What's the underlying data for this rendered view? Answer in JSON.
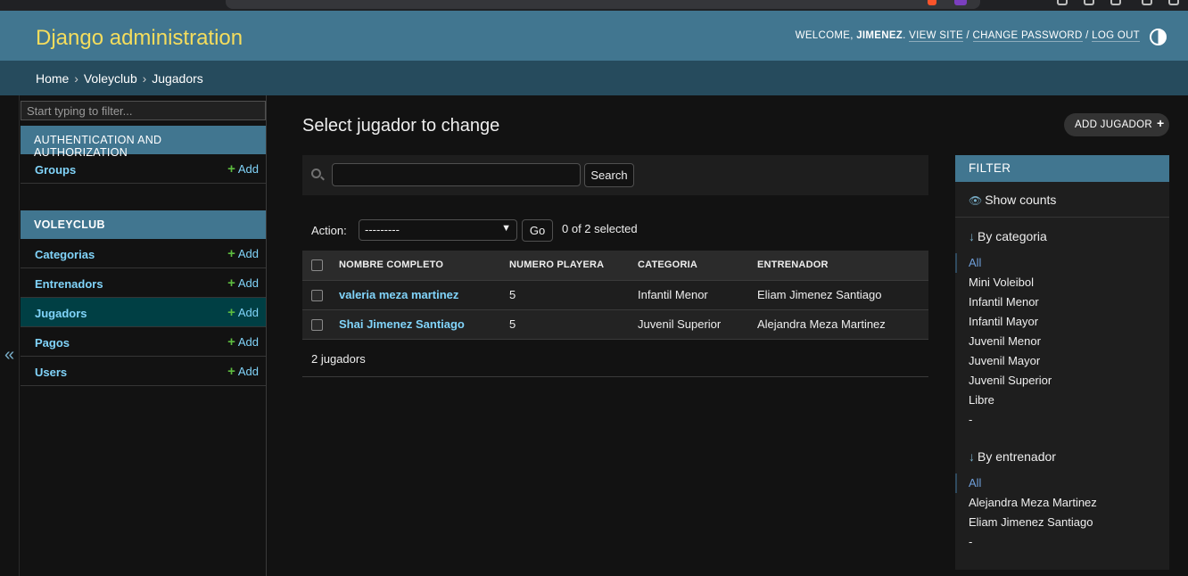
{
  "header": {
    "site_name": "Django administration",
    "welcome": "WELCOME,",
    "username": "JIMENEZ",
    "view_site": "VIEW SITE",
    "change_password": "CHANGE PASSWORD",
    "log_out": "LOG OUT",
    "separator": "/"
  },
  "breadcrumbs": {
    "home": "Home",
    "app": "Voleyclub",
    "current": "Jugadors",
    "separator": "›"
  },
  "sidebar": {
    "toggle_icon": "«",
    "filter_placeholder": "Start typing to filter...",
    "add_label": "Add",
    "modules": [
      {
        "caption": "AUTHENTICATION AND AUTHORIZATION",
        "models": [
          "Groups"
        ]
      },
      {
        "caption": "VOLEYCLUB",
        "models": [
          "Categorias",
          "Entrenadors",
          "Jugadors",
          "Pagos",
          "Users"
        ],
        "current": "Jugadors"
      }
    ]
  },
  "content": {
    "title": "Select jugador to change",
    "add_button": "ADD JUGADOR",
    "search": {
      "value": "",
      "button": "Search"
    },
    "actions": {
      "label": "Action:",
      "selected": "---------",
      "go": "Go",
      "counter": "0 of 2 selected"
    },
    "table": {
      "columns": [
        "NOMBRE COMPLETO",
        "NUMERO PLAYERA",
        "CATEGORIA",
        "ENTRENADOR"
      ],
      "rows": [
        {
          "nombre": "valeria meza martinez",
          "numero": "5",
          "categoria": "Infantil Menor",
          "entrenador": "Eliam Jimenez Santiago"
        },
        {
          "nombre": "Shai Jimenez Santiago",
          "numero": "5",
          "categoria": "Juvenil Superior",
          "entrenador": "Alejandra Meza Martinez"
        }
      ]
    },
    "paginator": "2 jugadors"
  },
  "filter": {
    "caption": "FILTER",
    "show_counts": "Show counts",
    "groups": [
      {
        "title": "By categoria",
        "options": [
          "All",
          "Mini Voleibol",
          "Infantil Menor",
          "Infantil Mayor",
          "Juvenil Menor",
          "Juvenil Mayor",
          "Juvenil Superior",
          "Libre",
          "-"
        ],
        "selected": "All"
      },
      {
        "title": "By entrenador",
        "options": [
          "All",
          "Alejandra Meza Martinez",
          "Eliam Jimenez Santiago",
          "-"
        ],
        "selected": "All"
      }
    ]
  },
  "icons": {
    "add": "plus-icon",
    "search": "search-icon",
    "eye": "eye-icon",
    "theme": "theme-toggle-icon",
    "sort": "arrow-down-icon"
  },
  "colors": {
    "header_bg": "#417690",
    "site_name": "#f5dd5d",
    "breadcrumbs_bg": "#264b5d",
    "link": "#81d4fa",
    "add_plus": "#5dbb3f",
    "current_row": "#003f44"
  }
}
